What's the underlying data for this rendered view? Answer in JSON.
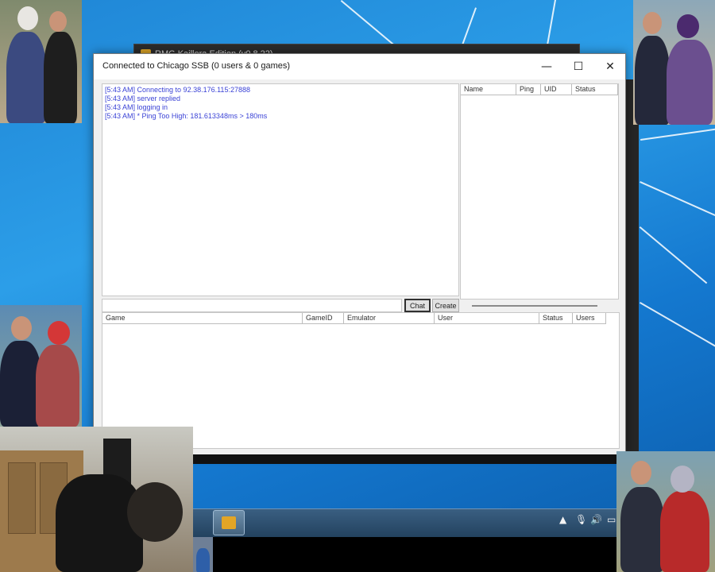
{
  "back_window": {
    "title": "RMG Kaillera Edition (v0.8.22)"
  },
  "main_window": {
    "title": "Connected to Chicago SSB (0 users & 0 games)",
    "controls": {
      "minimize_icon": "minimize-icon",
      "maximize_icon": "maximize-icon",
      "close_icon": "close-icon"
    }
  },
  "log": [
    "[5:43 AM] Connecting to 92.38.176.115:27888",
    "[5:43 AM] server replied",
    "[5:43 AM] logging in",
    "[5:43 AM] * Ping Too High: 181.613348ms > 180ms"
  ],
  "users_table": {
    "columns": [
      "Name",
      "Ping",
      "UID",
      "Status"
    ],
    "rows": []
  },
  "chat": {
    "input_value": "",
    "chat_button": "Chat",
    "create_button": "Create"
  },
  "games_table": {
    "columns": [
      "Game",
      "GameID",
      "Emulator",
      "User",
      "Status",
      "Users"
    ],
    "rows": []
  },
  "taskbar": {
    "tray_icons": [
      "chevron-up-icon",
      "microphone-icon",
      "speaker-icon",
      "monitor-icon"
    ]
  },
  "colors": {
    "log_text": "#3b43d6",
    "wallpaper": "#1f86d6",
    "taskbar": "#23425f"
  }
}
